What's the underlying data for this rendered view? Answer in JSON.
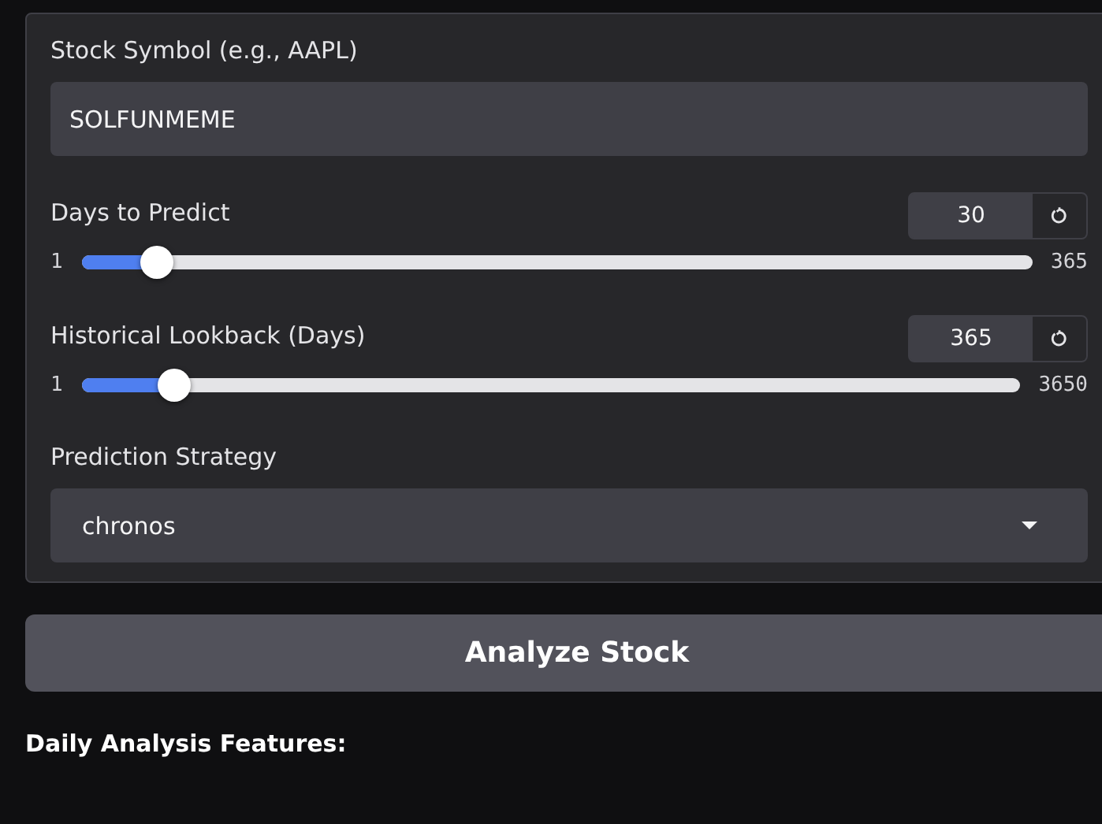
{
  "symbol": {
    "label": "Stock Symbol (e.g., AAPL)",
    "value": "SOLFUNMEME"
  },
  "sliders": [
    {
      "label": "Days to Predict",
      "value": "30",
      "min": "1",
      "max": "365",
      "level": 0.08
    },
    {
      "label": "Historical Lookback (Days)",
      "value": "365",
      "min": "1",
      "max": "3650",
      "level": 0.1
    }
  ],
  "strategy": {
    "label": "Prediction Strategy",
    "value": "chronos"
  },
  "analyze_button": "Analyze Stock",
  "features_heading": "Daily Analysis Features:"
}
